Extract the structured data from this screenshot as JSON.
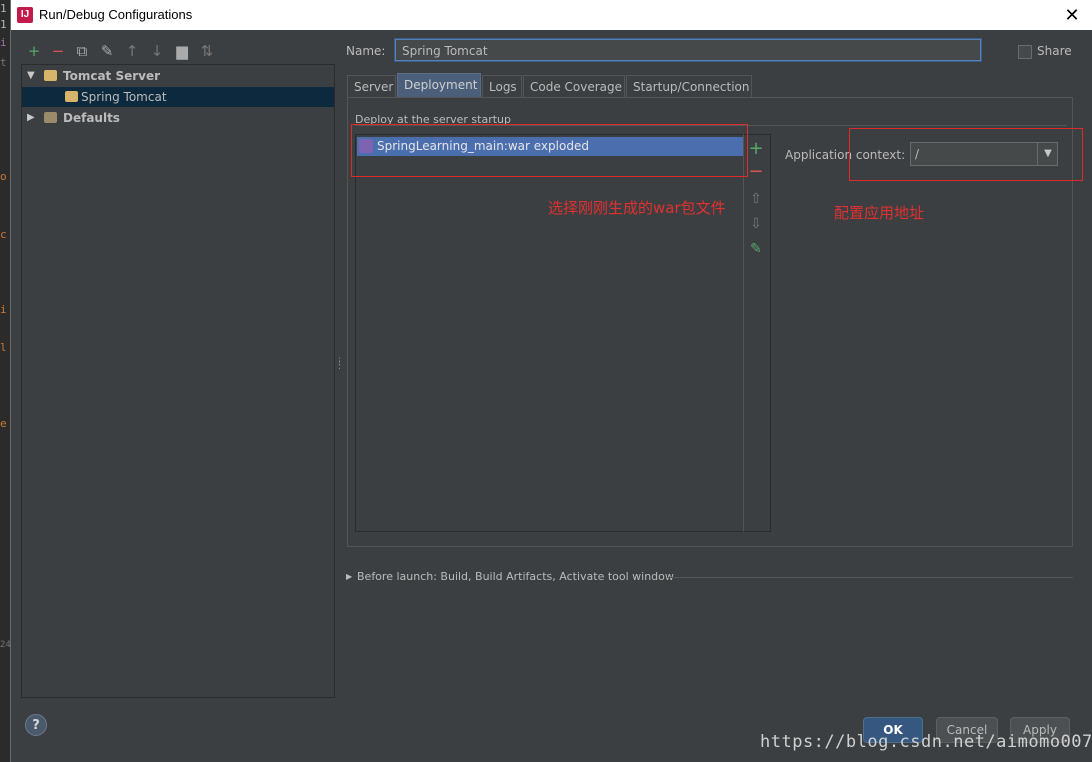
{
  "window": {
    "title": "Run/Debug Configurations",
    "app_icon": "intellij-icon",
    "close_symbol": "✕"
  },
  "backdrop": {
    "fragments": [
      "1",
      "1",
      "i",
      "t",
      "o",
      "c",
      "i",
      "l",
      "e",
      "24"
    ]
  },
  "toolbar": {
    "icons": [
      {
        "name": "add-icon",
        "glyph": "+",
        "color": "#59a869"
      },
      {
        "name": "remove-icon",
        "glyph": "−",
        "color": "#e05252"
      },
      {
        "name": "copy-icon",
        "glyph": "⧉",
        "color": "#aaaaaa"
      },
      {
        "name": "wrench-icon",
        "glyph": "✎",
        "color": "#aaaaaa"
      },
      {
        "name": "move-up-icon",
        "glyph": "↑",
        "color": "#777777"
      },
      {
        "name": "move-down-icon",
        "glyph": "↓",
        "color": "#777777"
      },
      {
        "name": "folder-icon",
        "glyph": "▆",
        "color": "#aaaaaa"
      },
      {
        "name": "sort-icon",
        "glyph": "⇅",
        "color": "#777777"
      }
    ]
  },
  "tree": {
    "items": [
      {
        "label": "Tomcat Server",
        "expanded": true
      },
      {
        "label": "Spring Tomcat",
        "selected": true
      },
      {
        "label": "Defaults",
        "expanded": false
      }
    ]
  },
  "form": {
    "name_label": "Name:",
    "name_value": "Spring Tomcat",
    "share_label": "Share",
    "share_checked": false
  },
  "tabs": [
    "Server",
    "Deployment",
    "Logs",
    "Code Coverage",
    "Startup/Connection"
  ],
  "active_tab": "Deployment",
  "deployment": {
    "header": "Deploy at the server startup",
    "artifacts": [
      "SpringLearning_main:war exploded"
    ],
    "context_label": "Application context:",
    "context_value": "/"
  },
  "annotations": {
    "artifact_note": "选择刚刚生成的war包文件",
    "context_note": "配置应用地址",
    "color": "#e02a2a"
  },
  "before_launch": {
    "text": "Before launch: Build, Build Artifacts, Activate tool window"
  },
  "buttons": {
    "ok": "OK",
    "cancel": "Cancel",
    "apply": "Apply",
    "help": "?"
  },
  "watermark": "https://blog.csdn.net/aimomo007",
  "colors": {
    "accent": "#4b6eaf",
    "background": "#3c3f41",
    "add_green": "#59a869",
    "remove_red": "#e05252"
  }
}
